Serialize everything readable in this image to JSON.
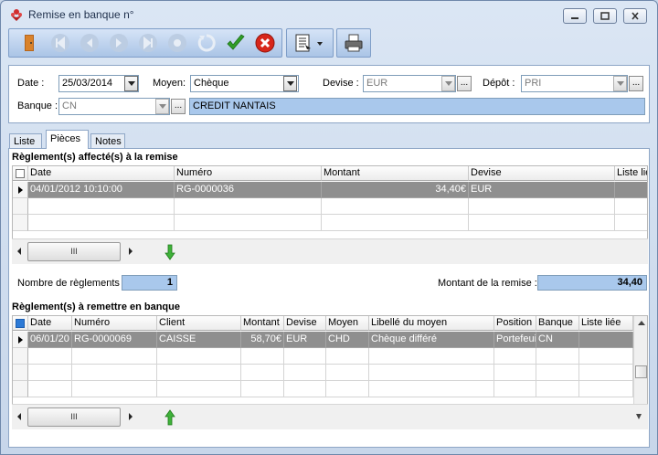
{
  "window": {
    "title": "Remise en banque n°"
  },
  "colors": {
    "accent_field": "#a9c8ec",
    "selected_row": "#8f8f8f",
    "valid": "#2f9e27",
    "cancel": "#d7261a"
  },
  "toolbar": {
    "icons": [
      "exit-door-icon",
      "first-record-icon",
      "previous-record-icon",
      "next-record-icon",
      "last-record-icon",
      "new-record-icon",
      "delete-record-icon",
      "validate-check-icon",
      "cancel-x-icon",
      "print-options-icon",
      "printer-icon"
    ]
  },
  "header": {
    "date_label": "Date :",
    "date_value": "25/03/2014",
    "moyen_label": "Moyen:",
    "moyen_value": "Chèque",
    "devise_label": "Devise :",
    "devise_value": "EUR",
    "depot_label": "Dépôt :",
    "depot_value": "PRI",
    "banque_label": "Banque :",
    "banque_value": "CN",
    "banque_name": "CREDIT NANTAIS",
    "ellipsis": "..."
  },
  "tabs": [
    {
      "label": "Liste"
    },
    {
      "label": "Pièces"
    },
    {
      "label": "Notes"
    }
  ],
  "affected": {
    "title": "Règlement(s) affecté(s) à la remise",
    "columns": [
      "Date",
      "Numéro",
      "Montant",
      "Devise",
      "Liste liée"
    ],
    "rows": [
      {
        "date": "04/01/2012 10:10:00",
        "numero": "RG-0000036",
        "montant": "34,40€",
        "devise": "EUR"
      }
    ]
  },
  "summary": {
    "count_label": "Nombre de règlements :",
    "count_value": "1",
    "amount_label": "Montant de la remise :",
    "amount_value": "34,40"
  },
  "pending": {
    "title": "Règlement(s) à remettre en banque",
    "columns": [
      "Date",
      "Numéro",
      "Client",
      "Montant",
      "Devise",
      "Moyen",
      "Libellé du moyen",
      "Position",
      "Banque",
      "Liste liée"
    ],
    "rows": [
      {
        "date": "06/01/20",
        "numero": "RG-0000069",
        "client": "CAISSE",
        "montant": "58,70€",
        "devise": "EUR",
        "moyen": "CHD",
        "libelle": "Chèque différé",
        "position": "Portefeuil",
        "banque": "CN"
      }
    ]
  },
  "scroll": {
    "thumb_glyph": "III"
  }
}
